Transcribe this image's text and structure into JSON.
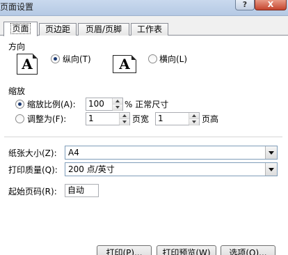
{
  "window": {
    "title": "页面设置",
    "help_label": "?",
    "close_label": "X"
  },
  "tabs": [
    {
      "label": "页面"
    },
    {
      "label": "页边距"
    },
    {
      "label": "页眉/页脚"
    },
    {
      "label": "工作表"
    }
  ],
  "orientation": {
    "header": "方向",
    "icon_letter": "A",
    "portrait_label": "纵向(T)",
    "landscape_label": "横向(L)",
    "selected": "portrait"
  },
  "scaling": {
    "header": "缩放",
    "adjust_label": "缩放比例(A):",
    "adjust_value": "100",
    "percent_suffix": "% 正常尺寸",
    "fit_label": "调整为(F):",
    "fit_wide_value": "1",
    "fit_wide_suffix": "页宽",
    "fit_tall_value": "1",
    "fit_tall_suffix": "页高",
    "selected": "adjust"
  },
  "paper": {
    "size_label": "纸张大小(Z):",
    "size_value": "A4",
    "quality_label": "打印质量(Q):",
    "quality_value": "200 点/英寸",
    "first_page_label": "起始页码(R):",
    "first_page_value": "自动"
  },
  "buttons": {
    "print": "打印(P)...",
    "preview": "打印预览(W)",
    "options": "选项(O)..."
  }
}
